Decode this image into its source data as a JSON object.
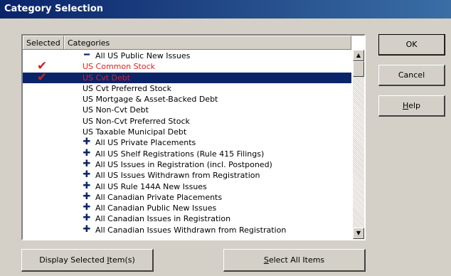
{
  "window": {
    "title": "Category Selection"
  },
  "columns": {
    "selected": "Selected",
    "categories": "Categories"
  },
  "rows": [
    {
      "label": "All US Public New Issues",
      "level": 0,
      "expander": "minus",
      "checked": false,
      "selected": false,
      "red": false
    },
    {
      "label": "US Common Stock",
      "level": 1,
      "expander": "",
      "checked": true,
      "selected": false,
      "red": true
    },
    {
      "label": "US Cvt Debt",
      "level": 1,
      "expander": "",
      "checked": true,
      "selected": true,
      "red": true
    },
    {
      "label": "US Cvt Preferred Stock",
      "level": 1,
      "expander": "",
      "checked": false,
      "selected": false,
      "red": false
    },
    {
      "label": "US Mortgage & Asset-Backed Debt",
      "level": 1,
      "expander": "",
      "checked": false,
      "selected": false,
      "red": false
    },
    {
      "label": "US Non-Cvt Debt",
      "level": 1,
      "expander": "",
      "checked": false,
      "selected": false,
      "red": false
    },
    {
      "label": "US Non-Cvt Preferred Stock",
      "level": 1,
      "expander": "",
      "checked": false,
      "selected": false,
      "red": false
    },
    {
      "label": "US Taxable Municipal Debt",
      "level": 1,
      "expander": "",
      "checked": false,
      "selected": false,
      "red": false
    },
    {
      "label": "All US Private Placements",
      "level": 0,
      "expander": "plus",
      "checked": false,
      "selected": false,
      "red": false
    },
    {
      "label": "All US Shelf Registrations (Rule 415 Filings)",
      "level": 0,
      "expander": "plus",
      "checked": false,
      "selected": false,
      "red": false
    },
    {
      "label": "All US Issues in Registration (incl. Postponed)",
      "level": 0,
      "expander": "plus",
      "checked": false,
      "selected": false,
      "red": false
    },
    {
      "label": "All US Issues Withdrawn from Registration",
      "level": 0,
      "expander": "plus",
      "checked": false,
      "selected": false,
      "red": false
    },
    {
      "label": "All US Rule 144A New Issues",
      "level": 0,
      "expander": "plus",
      "checked": false,
      "selected": false,
      "red": false
    },
    {
      "label": "All Canadian Private Placements",
      "level": 0,
      "expander": "plus",
      "checked": false,
      "selected": false,
      "red": false
    },
    {
      "label": "All Canadian Public New Issues",
      "level": 0,
      "expander": "plus",
      "checked": false,
      "selected": false,
      "red": false
    },
    {
      "label": "All Canadian Issues in Registration",
      "level": 0,
      "expander": "plus",
      "checked": false,
      "selected": false,
      "red": false
    },
    {
      "label": "All Canadian Issues Withdrawn from Registration",
      "level": 0,
      "expander": "plus",
      "checked": false,
      "selected": false,
      "red": false
    }
  ],
  "buttons": {
    "ok": "OK",
    "cancel": "Cancel",
    "help_pre": "",
    "help_ul": "H",
    "help_post": "elp",
    "display_pre": "Display Selected ",
    "display_ul": "I",
    "display_post": "tem(s)",
    "selectall_pre": "",
    "selectall_ul": "S",
    "selectall_post": "elect All Items"
  },
  "icons": {
    "check": "checkmark-icon",
    "plus": "plus-icon",
    "minus": "minus-icon",
    "scroll_up": "scroll-up-arrow-icon",
    "scroll_down": "scroll-down-arrow-icon"
  }
}
